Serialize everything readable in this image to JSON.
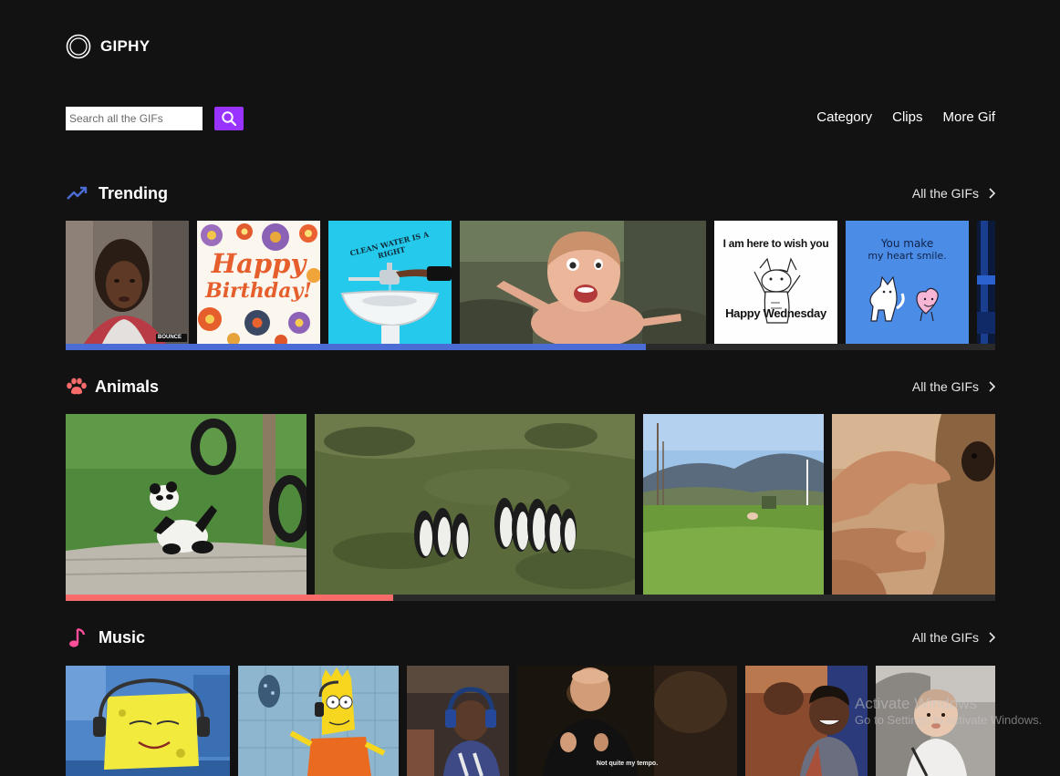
{
  "brand": "GIPHY",
  "search": {
    "placeholder": "Search all the GIFs"
  },
  "nav": [
    "Category",
    "Clips",
    "More Gif"
  ],
  "colors": {
    "purple": "#9933ff",
    "trending": "#4a6cd4",
    "animals": "#f76b6b",
    "music": "#ff4f9a"
  },
  "sections": {
    "trending": {
      "title": "Trending",
      "icon": "trending-up-icon",
      "link": "All the GIFs",
      "progress": 0.62
    },
    "animals": {
      "title": "Animals",
      "icon": "paw-icon",
      "link": "All the GIFs",
      "progress": 0.35
    },
    "music": {
      "title": "Music",
      "icon": "music-note-icon",
      "link": "All the GIFs"
    }
  },
  "gifs": {
    "bounce_badge": "BOUNCE",
    "birthday_1": "Happy",
    "birthday_2": "Birthday!",
    "water_caption": "CLEAN WATER IS A RIGHT",
    "wednesday_top": "I am here to wish you",
    "wednesday_bottom": "Happy Wednesday",
    "smile_1": "You make",
    "smile_2": "my heart smile.",
    "subtitle": "Not quite my tempo."
  },
  "watermark": {
    "line1": "Activate Windows",
    "line2": "Go to Settings to activate Windows."
  }
}
